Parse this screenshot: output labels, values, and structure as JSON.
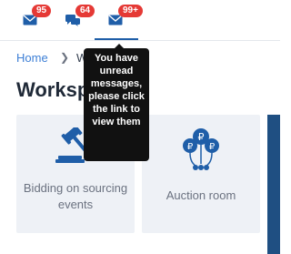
{
  "nav": {
    "mail_count": "95",
    "chat_count": "64",
    "notifications_count": "99+"
  },
  "tooltip": "You have unread messages, please click the link to view them",
  "breadcrumb": {
    "home": "Home",
    "current": "W"
  },
  "page_title": "Worksp",
  "cards": [
    {
      "label": "Bidding on sourcing events",
      "icon": "gavel-icon"
    },
    {
      "label": "Auction room",
      "icon": "ruble-coins-icon"
    }
  ],
  "colors": {
    "primary": "#1f5ea8",
    "badge": "#e53935",
    "card_bg": "#eef1f6",
    "link": "#3d7fd6"
  }
}
